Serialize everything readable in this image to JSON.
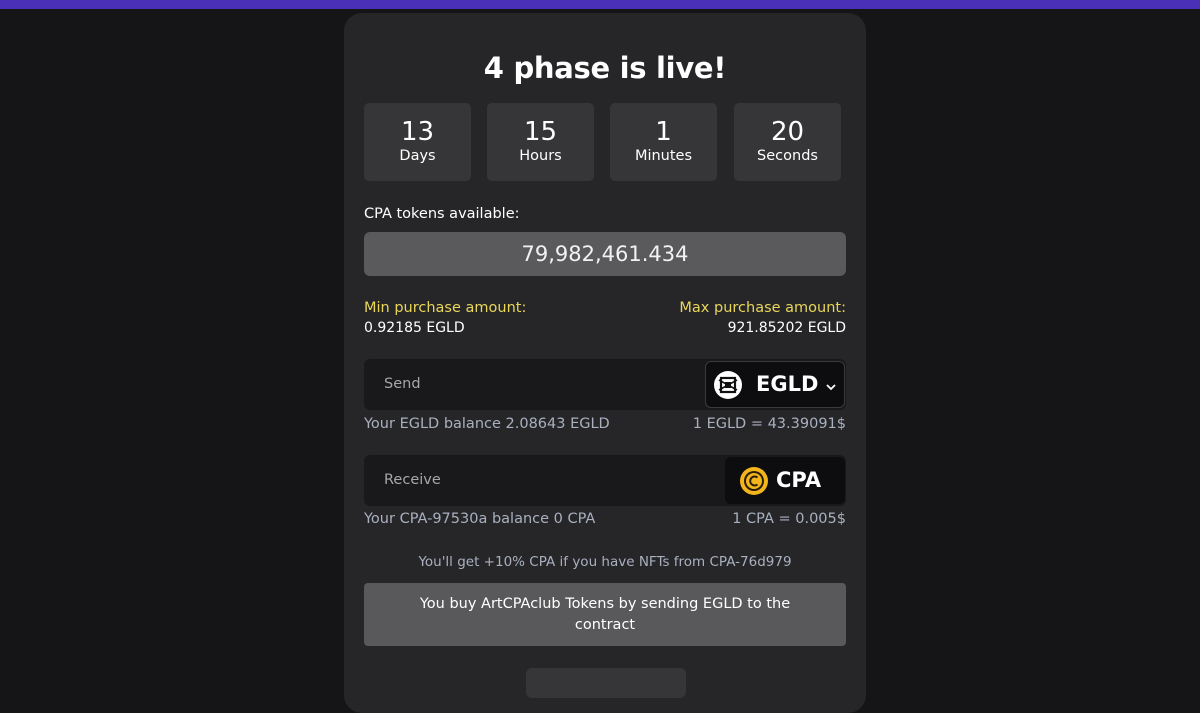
{
  "colors": {
    "accent_bar": "#4a2fb8",
    "label_yellow": "#e8d65a",
    "info_gray": "#a9b0bf",
    "cpa_gold": "#f2b51c"
  },
  "title": "4 phase is live!",
  "countdown": [
    {
      "value": "13",
      "unit": "Days"
    },
    {
      "value": "15",
      "unit": "Hours"
    },
    {
      "value": "1",
      "unit": "Minutes"
    },
    {
      "value": "20",
      "unit": "Seconds"
    }
  ],
  "available": {
    "label": "CPA tokens available:",
    "value": "79,982,461.434"
  },
  "limits": {
    "min_label": "Min purchase amount:",
    "min_value": "0.92185 EGLD",
    "max_label": "Max purchase amount:",
    "max_value": "921.85202 EGLD"
  },
  "send": {
    "label": "Send",
    "token": "EGLD",
    "token_icon": "egld-logo-icon",
    "balance": "Your EGLD balance 2.08643 EGLD",
    "rate": "1 EGLD = 43.39091$"
  },
  "receive": {
    "label": "Receive",
    "token": "CPA",
    "token_icon": "cpa-logo-icon",
    "balance": "Your CPA-97530a balance 0 CPA",
    "rate": "1 CPA = 0.005$"
  },
  "bonus_note": "You'll get +10% CPA if you have NFTs from CPA-76d979",
  "buy_note": "You buy ArtCPAclub Tokens by sending EGLD to the contract"
}
